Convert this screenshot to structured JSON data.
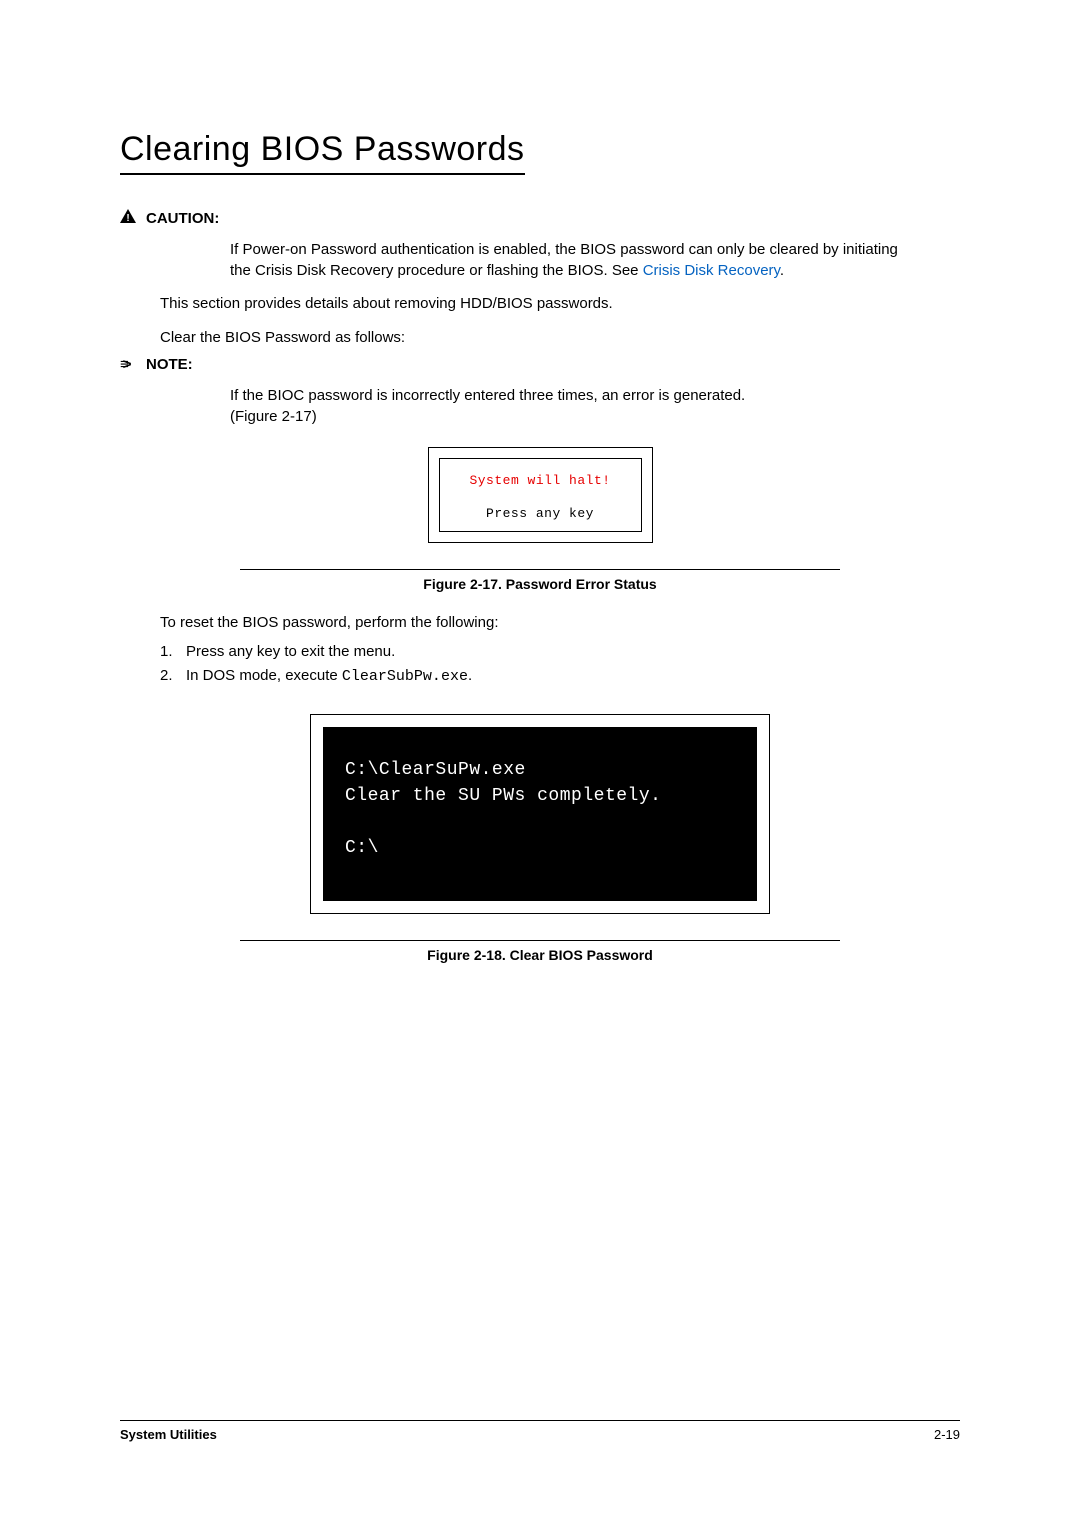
{
  "title": "Clearing BIOS Passwords",
  "caution": {
    "label": "CAUTION:",
    "body_pre": "If Power-on Password authentication is enabled, the BIOS password can only be cleared by initiating the Crisis Disk Recovery procedure or flashing the BIOS. See ",
    "link_text": "Crisis Disk Recovery",
    "body_post": "."
  },
  "intro1": "This section provides details about removing HDD/BIOS passwords.",
  "intro2": "Clear the BIOS Password as follows:",
  "note": {
    "label": "NOTE:",
    "body1": "If the BIOC password is incorrectly entered three times, an error is generated.",
    "body2": "(Figure 2-17)"
  },
  "error_box": {
    "line1": "System will halt!",
    "line2": "Press any key"
  },
  "figure17_caption": "Figure 2-17.   Password Error Status",
  "reset_intro": "To reset the BIOS password, perform the following:",
  "steps": {
    "s1": "Press any key to exit the menu.",
    "s2_pre": "In DOS mode, execute ",
    "s2_code": "ClearSubPw.exe",
    "s2_post": "."
  },
  "terminal": {
    "l1": "C:\\ClearSuPw.exe",
    "l2": "Clear the SU PWs completely.",
    "l3": "C:\\"
  },
  "figure18_caption": "Figure 2-18.   Clear BIOS Password",
  "footer": {
    "left": "System Utilities",
    "right": "2-19"
  }
}
